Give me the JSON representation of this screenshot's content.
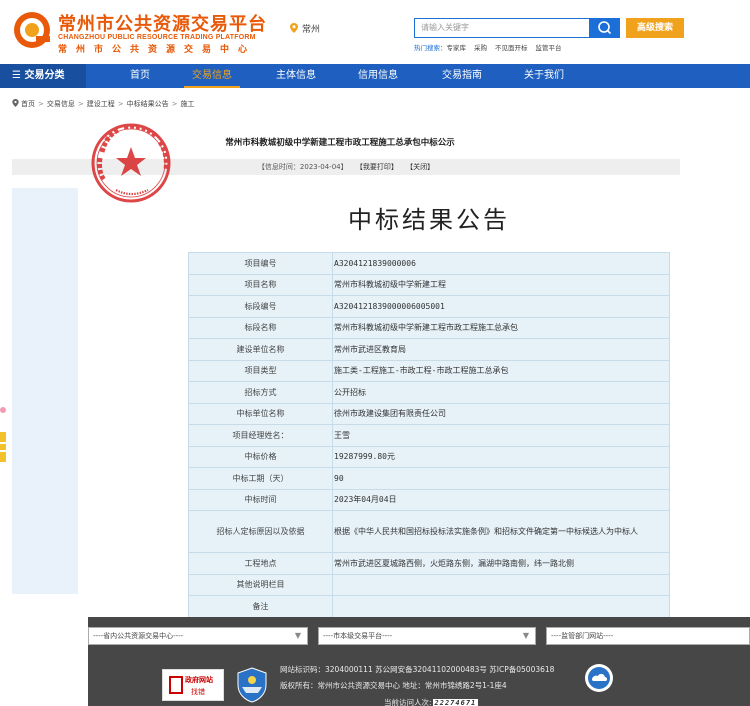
{
  "header": {
    "logo_cn": "常州市公共资源交易平台",
    "logo_en": "CHANGZHOU PUBLIC RESOURCE TRADING PLATFORM",
    "logo_cn2": "常州市公共资源交易中心",
    "location": "常州",
    "search_placeholder": "请输入关键字",
    "adv_search": "高级搜索",
    "hot_label": "热门搜索：",
    "hot_items": [
      "专家库",
      "采购",
      "不见面开标",
      "监管平台"
    ]
  },
  "nav": {
    "category": "☰ 交易分类",
    "items": [
      "首页",
      "交易信息",
      "主体信息",
      "信用信息",
      "交易指南",
      "关于我们"
    ]
  },
  "breadcrumb": [
    "首页",
    "交易信息",
    "建设工程",
    "中标结果公告",
    "施工"
  ],
  "page": {
    "title": "常州市科教城初级中学新建工程市政工程施工总承包中标公示",
    "info_time": "【信息时间：2023-04-04】",
    "print": "【我要打印】",
    "close": "【关闭】",
    "main_heading": "中标结果公告"
  },
  "table": [
    {
      "k": "项目编号",
      "v": "A3204121839000006"
    },
    {
      "k": "项目名称",
      "v": "常州市科教城初级中学新建工程"
    },
    {
      "k": "标段编号",
      "v": "A3204121839000006005001"
    },
    {
      "k": "标段名称",
      "v": "常州市科教城初级中学新建工程市政工程施工总承包"
    },
    {
      "k": "建设单位名称",
      "v": "常州市武进区教育局"
    },
    {
      "k": "项目类型",
      "v": "施工类-工程施工-市政工程-市政工程施工总承包"
    },
    {
      "k": "招标方式",
      "v": "公开招标"
    },
    {
      "k": "中标单位名称",
      "v": "徐州市政建设集团有限责任公司"
    },
    {
      "k": "项目经理姓名：",
      "v": "王雪"
    },
    {
      "k": "中标价格",
      "v": "19287999.80元"
    },
    {
      "k": "中标工期（天）",
      "v": "90"
    },
    {
      "k": "中标时间",
      "v": "2023年04月04日"
    },
    {
      "k": "招标人定标原因以及依据",
      "v": "根据《中华人民共和国招标投标法实施条例》和招标文件确定第一中标候选人为中标人"
    },
    {
      "k": "工程地点",
      "v": "常州市武进区夏城路西侧，火炬路东侧，漏湖中路南侧，纬一路北侧"
    },
    {
      "k": "其他说明栏目",
      "v": ""
    },
    {
      "k": "备注",
      "v": ""
    }
  ],
  "footer": {
    "select1": "----省内公共资源交易中心----",
    "select2": "----市本级交易平台----",
    "select3": "----监管部门网站----",
    "gov_t1": "政府网站",
    "gov_t2": "找错",
    "line1": "网站标识码：3204000111  苏公网安备32041102000483号    苏ICP备05003618",
    "line2": "版权所有：常州市公共资源交易中心          地址：常州市锦绣路2号1-1座4",
    "counter_label": "当前访问人次:",
    "counter_value": "22274671"
  },
  "colors": {
    "brand_orange": "#e85a0a",
    "nav_blue": "#1e5fbf",
    "accent_gold": "#f0a21d",
    "table_bg": "#e6f2f8",
    "footer_bg": "#474747",
    "seal_red": "#d61f1f"
  }
}
